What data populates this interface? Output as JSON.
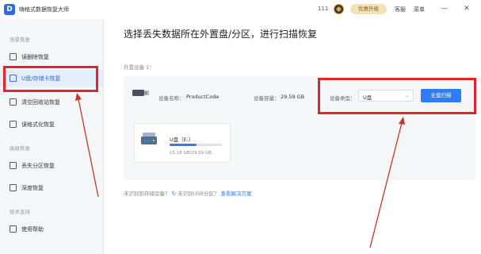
{
  "titlebar": {
    "logo_letter": "D",
    "app_title": "嗨格式数据恢复大师",
    "user_id": "111",
    "upgrade_label": "优惠升级",
    "service_label": "客服",
    "menu_label": "菜单",
    "minimize_glyph": "—",
    "close_glyph": "✕"
  },
  "sidebar": {
    "sections": [
      {
        "label": "场景恢复"
      },
      {
        "label": "高级恢复"
      },
      {
        "label": "技术支持"
      }
    ],
    "items": [
      {
        "label": "误删除恢复",
        "icon": "document-icon"
      },
      {
        "label": "U盘/存储卡恢复",
        "icon": "usb-drive-icon",
        "active": true
      },
      {
        "label": "清空回收站恢复",
        "icon": "recycle-bin-icon"
      },
      {
        "label": "误格式化恢复",
        "icon": "format-icon"
      },
      {
        "label": "丢失分区恢复",
        "icon": "partition-icon"
      },
      {
        "label": "深度恢复",
        "icon": "deep-scan-icon"
      },
      {
        "label": "使用帮助",
        "icon": "help-icon"
      }
    ]
  },
  "main": {
    "heading": "选择丢失数据所在外置盘/分区，进行扫描恢复",
    "external_label": "外置设备 1：",
    "device": {
      "name_label": "设备名称：",
      "name_value": "ProductCode",
      "capacity_label": "设备容量：",
      "capacity_value": "29.59 GB",
      "type_label": "设备类型：",
      "type_value": "U盘",
      "scan_button": "全盘扫描"
    },
    "drive": {
      "name": "U盘（E:）",
      "size_text": "15.18 GB/29.59 GB",
      "used_fraction": 0.51
    },
    "footer": {
      "prefix": "未识别到存储设备？",
      "refresh_glyph": "↻",
      "middle": "未识别USB分区？",
      "link": "查看解决方案"
    }
  },
  "colors": {
    "accent": "#2f7cf6",
    "annotation": "#e0262a",
    "active_bg": "#e4edfc"
  }
}
